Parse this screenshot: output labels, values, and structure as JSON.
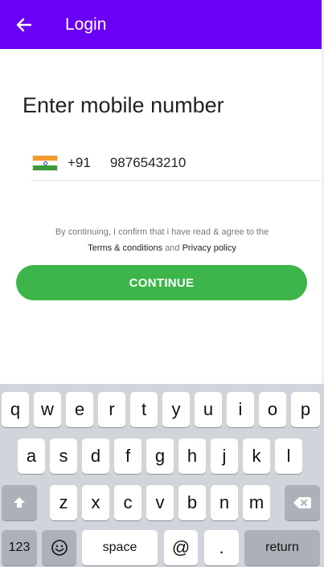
{
  "app_bar": {
    "title": "Login",
    "back_icon": "arrow-left-icon",
    "color": "#6a00f4"
  },
  "form": {
    "heading": "Enter mobile number",
    "country_flag": "india-flag-icon",
    "country_code": "+91",
    "phone_value": "9876543210"
  },
  "consent": {
    "line1": "By continuing, I confirm that i have read & agree to the",
    "terms_link": "Terms & conditions",
    "and_text": "and",
    "privacy_link": "Privacy policy"
  },
  "continue_button": {
    "label": "CONTINUE",
    "color": "#3db54a"
  },
  "keyboard": {
    "row1": [
      "q",
      "w",
      "e",
      "r",
      "t",
      "y",
      "u",
      "i",
      "o",
      "p"
    ],
    "row2": [
      "a",
      "s",
      "d",
      "f",
      "g",
      "h",
      "j",
      "k",
      "l"
    ],
    "row3": [
      "z",
      "x",
      "c",
      "v",
      "b",
      "n",
      "m"
    ],
    "shift_icon": "shift-icon",
    "delete_icon": "backspace-icon",
    "numbers_label": "123",
    "emoji_icon": "emoji-icon",
    "space_label": "space",
    "at_label": "@",
    "dot_label": ".",
    "return_label": "return"
  }
}
